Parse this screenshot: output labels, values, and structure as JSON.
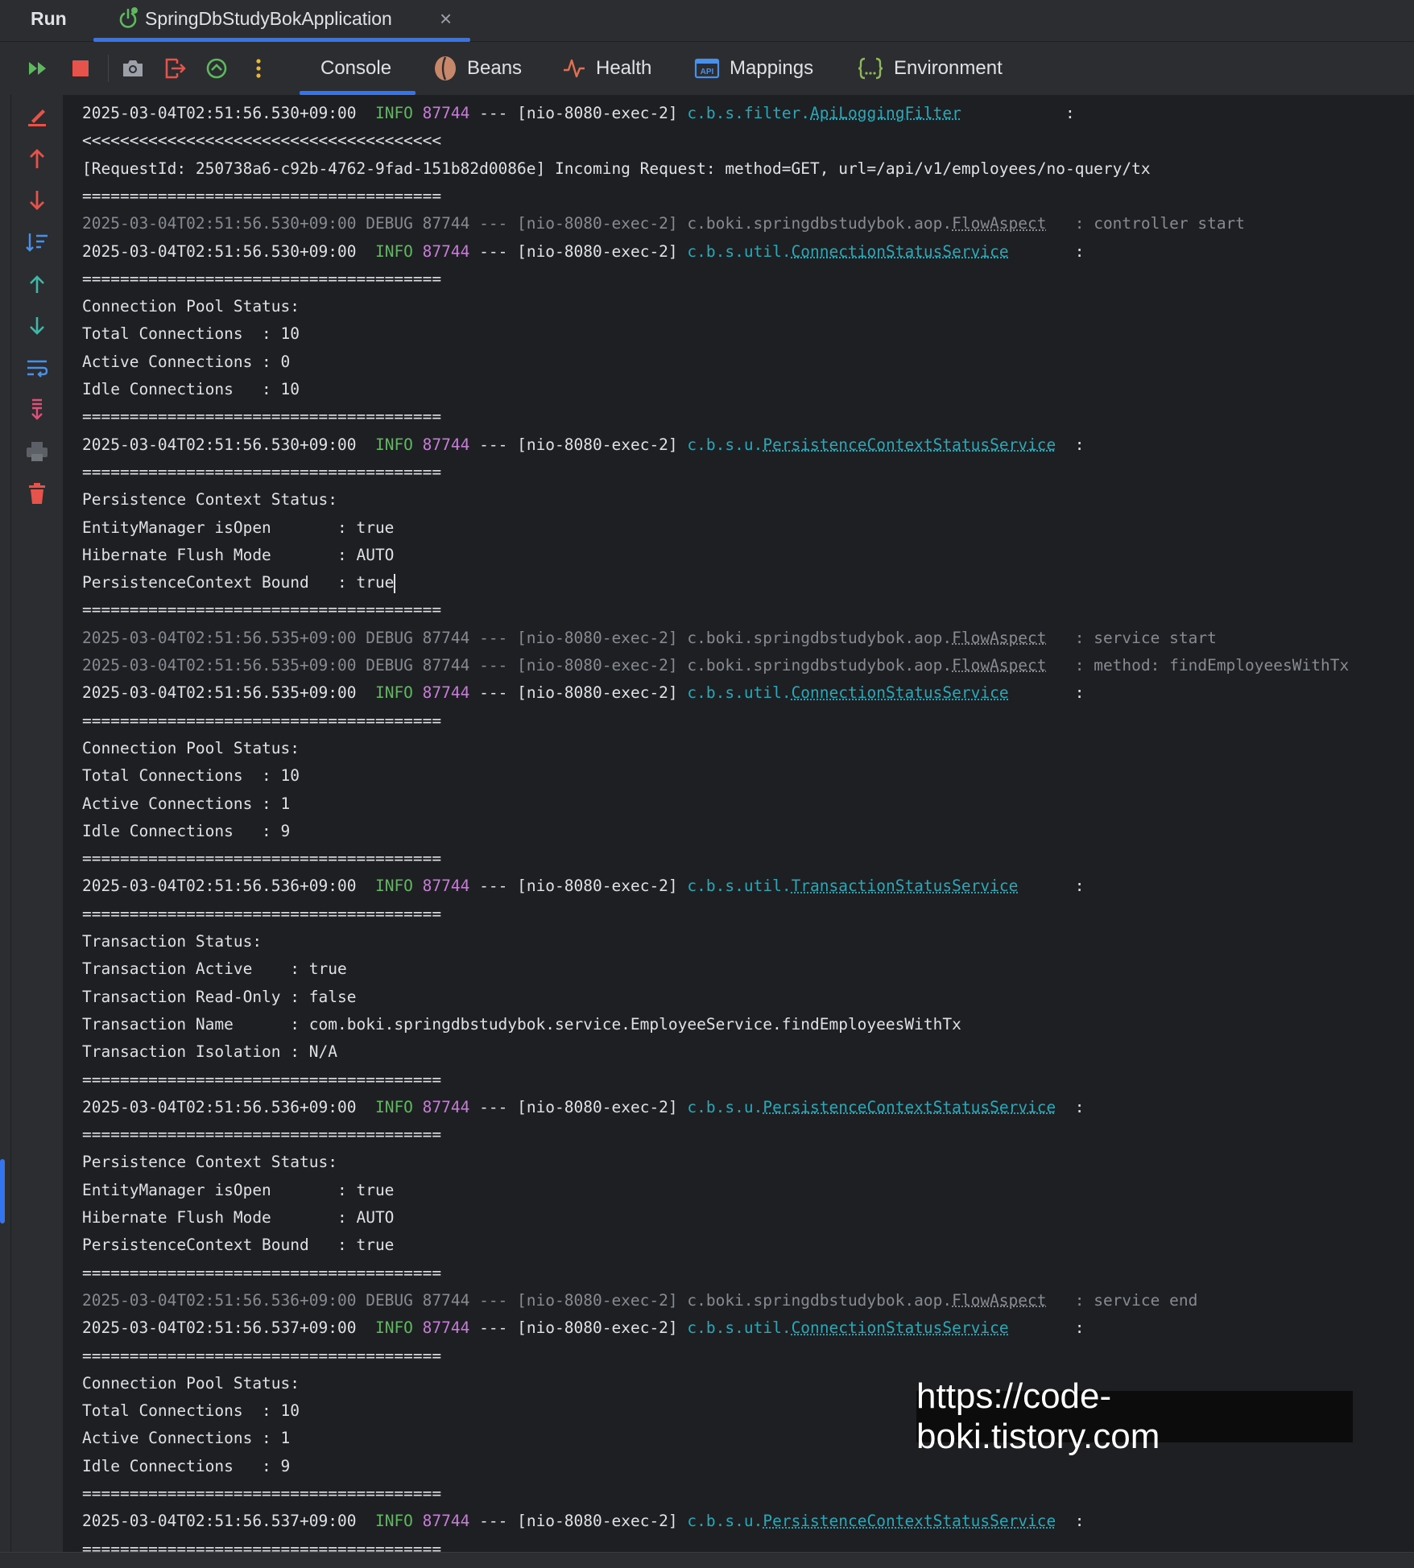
{
  "header": {
    "run_label": "Run",
    "app_tab": "SpringDbStudyBokApplication",
    "close_glyph": "×"
  },
  "toolbar": {
    "tabs": [
      "Console",
      "Beans",
      "Health",
      "Mappings",
      "Environment"
    ],
    "active_tab": "Console"
  },
  "sidebar": {
    "icons": [
      "clear-all-icon",
      "up-arrow-icon",
      "down-arrow-icon",
      "sort-icon",
      "scroll-up-icon",
      "scroll-down-icon",
      "soft-wrap-icon",
      "scroll-to-end-icon",
      "print-icon",
      "trash-icon"
    ]
  },
  "console": {
    "lines": [
      {
        "t": "log",
        "ts": "2025-03-04T02:51:56.530+09:00",
        "lvl": " INFO",
        "pid": "87744",
        "thr": "--- [nio-8080-exec-2]",
        "pkg": "c.b.s.filter.",
        "cls": "ApiLoggingFilter",
        "pad": "          ",
        "msg": " :"
      },
      {
        "t": "text",
        "text": "<<<<<<<<<<<<<<<<<<<<<<<<<<<<<<<<<<<<<<"
      },
      {
        "t": "text",
        "text": "[RequestId: 250738a6-c92b-4762-9fad-151b82d0086e] Incoming Request: method=GET, url=/api/v1/employees/no-query/tx"
      },
      {
        "t": "text",
        "text": "======================================"
      },
      {
        "t": "debug",
        "pre": "2025-03-04T02:51:56.530+09:00 DEBUG 87744 --- [nio-8080-exec-2] c.boki.springdbstudybok.aop.",
        "cls": "FlowAspect",
        "msg": "   : controller start"
      },
      {
        "t": "log",
        "ts": "2025-03-04T02:51:56.530+09:00",
        "lvl": " INFO",
        "pid": "87744",
        "thr": "--- [nio-8080-exec-2]",
        "pkg": "c.b.s.util.",
        "cls": "ConnectionStatusService",
        "pad": "      ",
        "msg": " :"
      },
      {
        "t": "text",
        "text": "======================================"
      },
      {
        "t": "text",
        "text": "Connection Pool Status:"
      },
      {
        "t": "text",
        "text": "Total Connections  : 10"
      },
      {
        "t": "text",
        "text": "Active Connections : 0"
      },
      {
        "t": "text",
        "text": "Idle Connections   : 10"
      },
      {
        "t": "text",
        "text": "======================================"
      },
      {
        "t": "log",
        "ts": "2025-03-04T02:51:56.530+09:00",
        "lvl": " INFO",
        "pid": "87744",
        "thr": "--- [nio-8080-exec-2]",
        "pkg": "c.b.s.u.",
        "cls": "PersistenceContextStatusService",
        "pad": " ",
        "msg": " :"
      },
      {
        "t": "text",
        "text": "======================================"
      },
      {
        "t": "text",
        "text": "Persistence Context Status:"
      },
      {
        "t": "text",
        "text": "EntityManager isOpen       : true"
      },
      {
        "t": "text",
        "text": "Hibernate Flush Mode       : AUTO"
      },
      {
        "t": "text",
        "text": "PersistenceContext Bound   : true",
        "caret": true
      },
      {
        "t": "text",
        "text": "======================================"
      },
      {
        "t": "debug",
        "pre": "2025-03-04T02:51:56.535+09:00 DEBUG 87744 --- [nio-8080-exec-2] c.boki.springdbstudybok.aop.",
        "cls": "FlowAspect",
        "msg": "   : service start"
      },
      {
        "t": "debug",
        "pre": "2025-03-04T02:51:56.535+09:00 DEBUG 87744 --- [nio-8080-exec-2] c.boki.springdbstudybok.aop.",
        "cls": "FlowAspect",
        "msg": "   : method: findEmployeesWithTx"
      },
      {
        "t": "log",
        "ts": "2025-03-04T02:51:56.535+09:00",
        "lvl": " INFO",
        "pid": "87744",
        "thr": "--- [nio-8080-exec-2]",
        "pkg": "c.b.s.util.",
        "cls": "ConnectionStatusService",
        "pad": "      ",
        "msg": " :"
      },
      {
        "t": "text",
        "text": "======================================"
      },
      {
        "t": "text",
        "text": "Connection Pool Status:"
      },
      {
        "t": "text",
        "text": "Total Connections  : 10"
      },
      {
        "t": "text",
        "text": "Active Connections : 1"
      },
      {
        "t": "text",
        "text": "Idle Connections   : 9"
      },
      {
        "t": "text",
        "text": "======================================"
      },
      {
        "t": "log",
        "ts": "2025-03-04T02:51:56.536+09:00",
        "lvl": " INFO",
        "pid": "87744",
        "thr": "--- [nio-8080-exec-2]",
        "pkg": "c.b.s.util.",
        "cls": "TransactionStatusService",
        "pad": "     ",
        "msg": " :"
      },
      {
        "t": "text",
        "text": "======================================"
      },
      {
        "t": "text",
        "text": "Transaction Status:"
      },
      {
        "t": "text",
        "text": "Transaction Active    : true"
      },
      {
        "t": "text",
        "text": "Transaction Read-Only : false"
      },
      {
        "t": "text",
        "text": "Transaction Name      : com.boki.springdbstudybok.service.EmployeeService.findEmployeesWithTx"
      },
      {
        "t": "text",
        "text": "Transaction Isolation : N/A"
      },
      {
        "t": "text",
        "text": "======================================"
      },
      {
        "t": "log",
        "ts": "2025-03-04T02:51:56.536+09:00",
        "lvl": " INFO",
        "pid": "87744",
        "thr": "--- [nio-8080-exec-2]",
        "pkg": "c.b.s.u.",
        "cls": "PersistenceContextStatusService",
        "pad": " ",
        "msg": " :"
      },
      {
        "t": "text",
        "text": "======================================"
      },
      {
        "t": "text",
        "text": "Persistence Context Status:"
      },
      {
        "t": "text",
        "text": "EntityManager isOpen       : true"
      },
      {
        "t": "text",
        "text": "Hibernate Flush Mode       : AUTO"
      },
      {
        "t": "text",
        "text": "PersistenceContext Bound   : true"
      },
      {
        "t": "text",
        "text": "======================================"
      },
      {
        "t": "debug",
        "pre": "2025-03-04T02:51:56.536+09:00 DEBUG 87744 --- [nio-8080-exec-2] c.boki.springdbstudybok.aop.",
        "cls": "FlowAspect",
        "msg": "   : service end"
      },
      {
        "t": "log",
        "ts": "2025-03-04T02:51:56.537+09:00",
        "lvl": " INFO",
        "pid": "87744",
        "thr": "--- [nio-8080-exec-2]",
        "pkg": "c.b.s.util.",
        "cls": "ConnectionStatusService",
        "pad": "      ",
        "msg": " :"
      },
      {
        "t": "text",
        "text": "======================================"
      },
      {
        "t": "text",
        "text": "Connection Pool Status:"
      },
      {
        "t": "text",
        "text": "Total Connections  : 10"
      },
      {
        "t": "text",
        "text": "Active Connections : 1"
      },
      {
        "t": "text",
        "text": "Idle Connections   : 9"
      },
      {
        "t": "text",
        "text": "======================================"
      },
      {
        "t": "log",
        "ts": "2025-03-04T02:51:56.537+09:00",
        "lvl": " INFO",
        "pid": "87744",
        "thr": "--- [nio-8080-exec-2]",
        "pkg": "c.b.s.u.",
        "cls": "PersistenceContextStatusService",
        "pad": " ",
        "msg": " :"
      },
      {
        "t": "text",
        "text": "======================================"
      }
    ]
  },
  "watermark": {
    "text": "https://code-boki.tistory.com"
  },
  "colors": {
    "info": "#5fb85f",
    "pid": "#c77dd7",
    "logger": "#2aa8b8",
    "debug": "#868a91",
    "accent": "#3574f0",
    "stop": "#e5534b"
  }
}
